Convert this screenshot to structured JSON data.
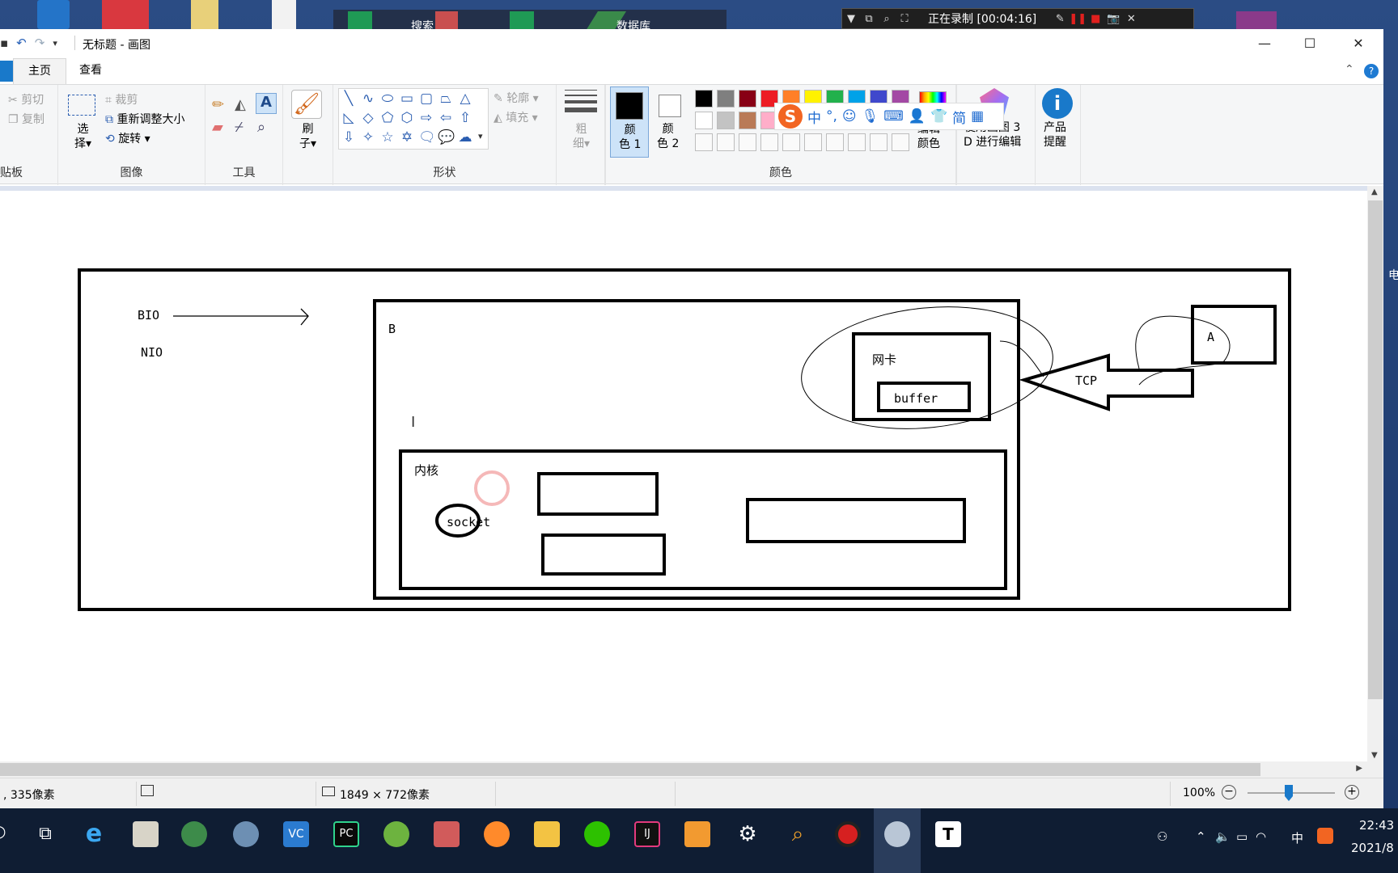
{
  "recorder": {
    "status": "正在录制 [00:04:16]"
  },
  "desktop_labels": {
    "search": "搜索",
    "database": "数据库"
  },
  "window": {
    "title": "无标题 - 画图"
  },
  "tabs": [
    {
      "label": "主页"
    },
    {
      "label": "查看"
    }
  ],
  "ribbon": {
    "clipboard": {
      "cut": "剪切",
      "copy": "复制",
      "label": "贴板"
    },
    "image": {
      "select": "选",
      "select2": "择",
      "crop": "裁剪",
      "resize": "重新调整大小",
      "rotate": "旋转",
      "label": "图像"
    },
    "tools": {
      "label": "工具"
    },
    "brush": {
      "line1": "刷",
      "line2": "子"
    },
    "shapes": {
      "outline": "轮廓",
      "fill": "填充",
      "label": "形状"
    },
    "size": {
      "line1": "粗",
      "line2": "细"
    },
    "color1": {
      "line1": "颜",
      "line2": "色 1"
    },
    "color2": {
      "line1": "颜",
      "line2": "色 2"
    },
    "colors": {
      "label": "颜色"
    },
    "edit_colors": {
      "line1": "编辑",
      "line2": "颜色"
    },
    "paint3d": {
      "line1": "使用画图 3",
      "line2": "D 进行编辑"
    },
    "alert": {
      "line1": "产品",
      "line2": "提醒"
    },
    "palette_row1": [
      "#000000",
      "#7f7f7f",
      "#880015",
      "#ed1c24",
      "#ff7f27",
      "#fff200",
      "#22b14c",
      "#00a2e8",
      "#3f48cc",
      "#a349a4"
    ],
    "palette_row2": [
      "#ffffff",
      "#c3c3c3",
      "#b97a57",
      "#ffaec9",
      "#ffc90e",
      "#efe4b0",
      "#b5e61d",
      "#99d9ea",
      "#7092be",
      "#c8bfe7"
    ]
  },
  "ime": {
    "logo": "S",
    "mode": "中",
    "punct": "°,",
    "simp": "简"
  },
  "drawing": {
    "bio": "BIO",
    "nio": "NIO",
    "b": "B",
    "nic": "网卡",
    "buffer": "buffer",
    "tcp": "TCP",
    "a": "A",
    "kernel": "内核",
    "socket": "socket"
  },
  "status": {
    "cursor": ", 335像素",
    "size": "1849 × 772像素",
    "zoom": "100%"
  },
  "taskbar": {
    "time": "22:43",
    "date": "2021/8",
    "ime": "中"
  },
  "side_char": "电"
}
